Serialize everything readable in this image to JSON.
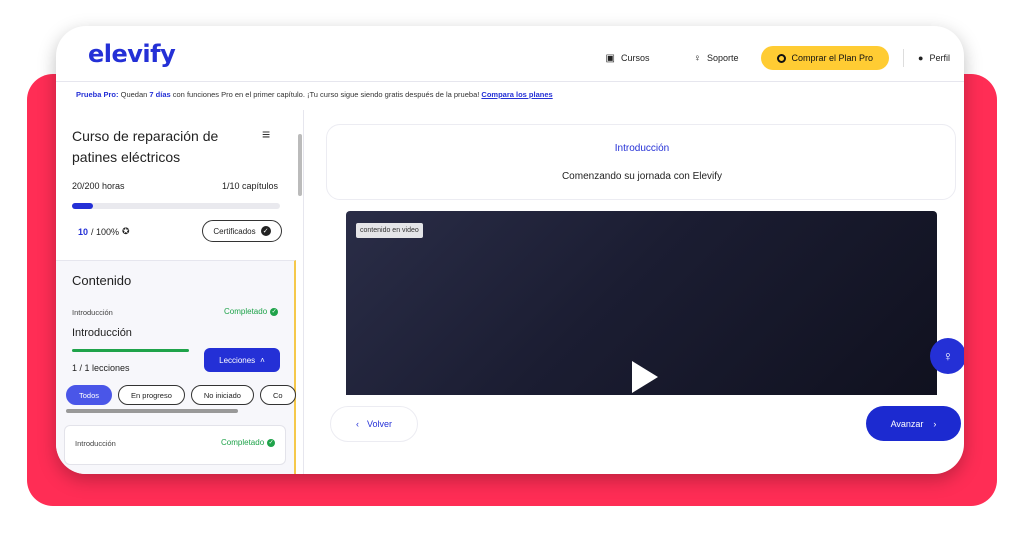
{
  "header": {
    "logo": "elevify",
    "nav": {
      "courses": "Cursos",
      "support": "Soporte",
      "cta": "Comprar el Plan Pro",
      "profile": "Perfil"
    }
  },
  "promo": {
    "lead": "Prueba Pro:",
    "text_1": "Quedan",
    "days": "7 días",
    "text_2": "con funciones Pro en el primer capítulo. ¡Tu curso sigue siendo gratis después de la prueba!",
    "link": "Compara los planes"
  },
  "sidebar": {
    "course_title": "Curso de reparación de patines eléctricos",
    "hours": "20/200 horas",
    "chapters": "1/10 capítulos",
    "progress": 0.1,
    "score_num": "10",
    "score_total": "/ 100%",
    "certificates_label": "Certificados",
    "content": {
      "title": "Contenido",
      "section_small": "Introducción",
      "completed_label": "Completado",
      "section_big": "Introducción",
      "lessons_count": "1 / 1 lecciones",
      "lessons_button": "Lecciones",
      "filters": [
        "Todos",
        "En progreso",
        "No iniciado",
        "Co"
      ],
      "card": {
        "label": "Introducción",
        "status": "Completado"
      }
    }
  },
  "main": {
    "section_label": "Introducción",
    "section_title": "Comenzando su jornada con Elevify",
    "video_tag": "contenido en video",
    "back_label": "Volver",
    "next_label": "Avanzar"
  },
  "colors": {
    "brand": "#2430d6",
    "accent_yellow": "#ffcc33",
    "success": "#1fa34a",
    "background_pink": "#ff2d55"
  }
}
